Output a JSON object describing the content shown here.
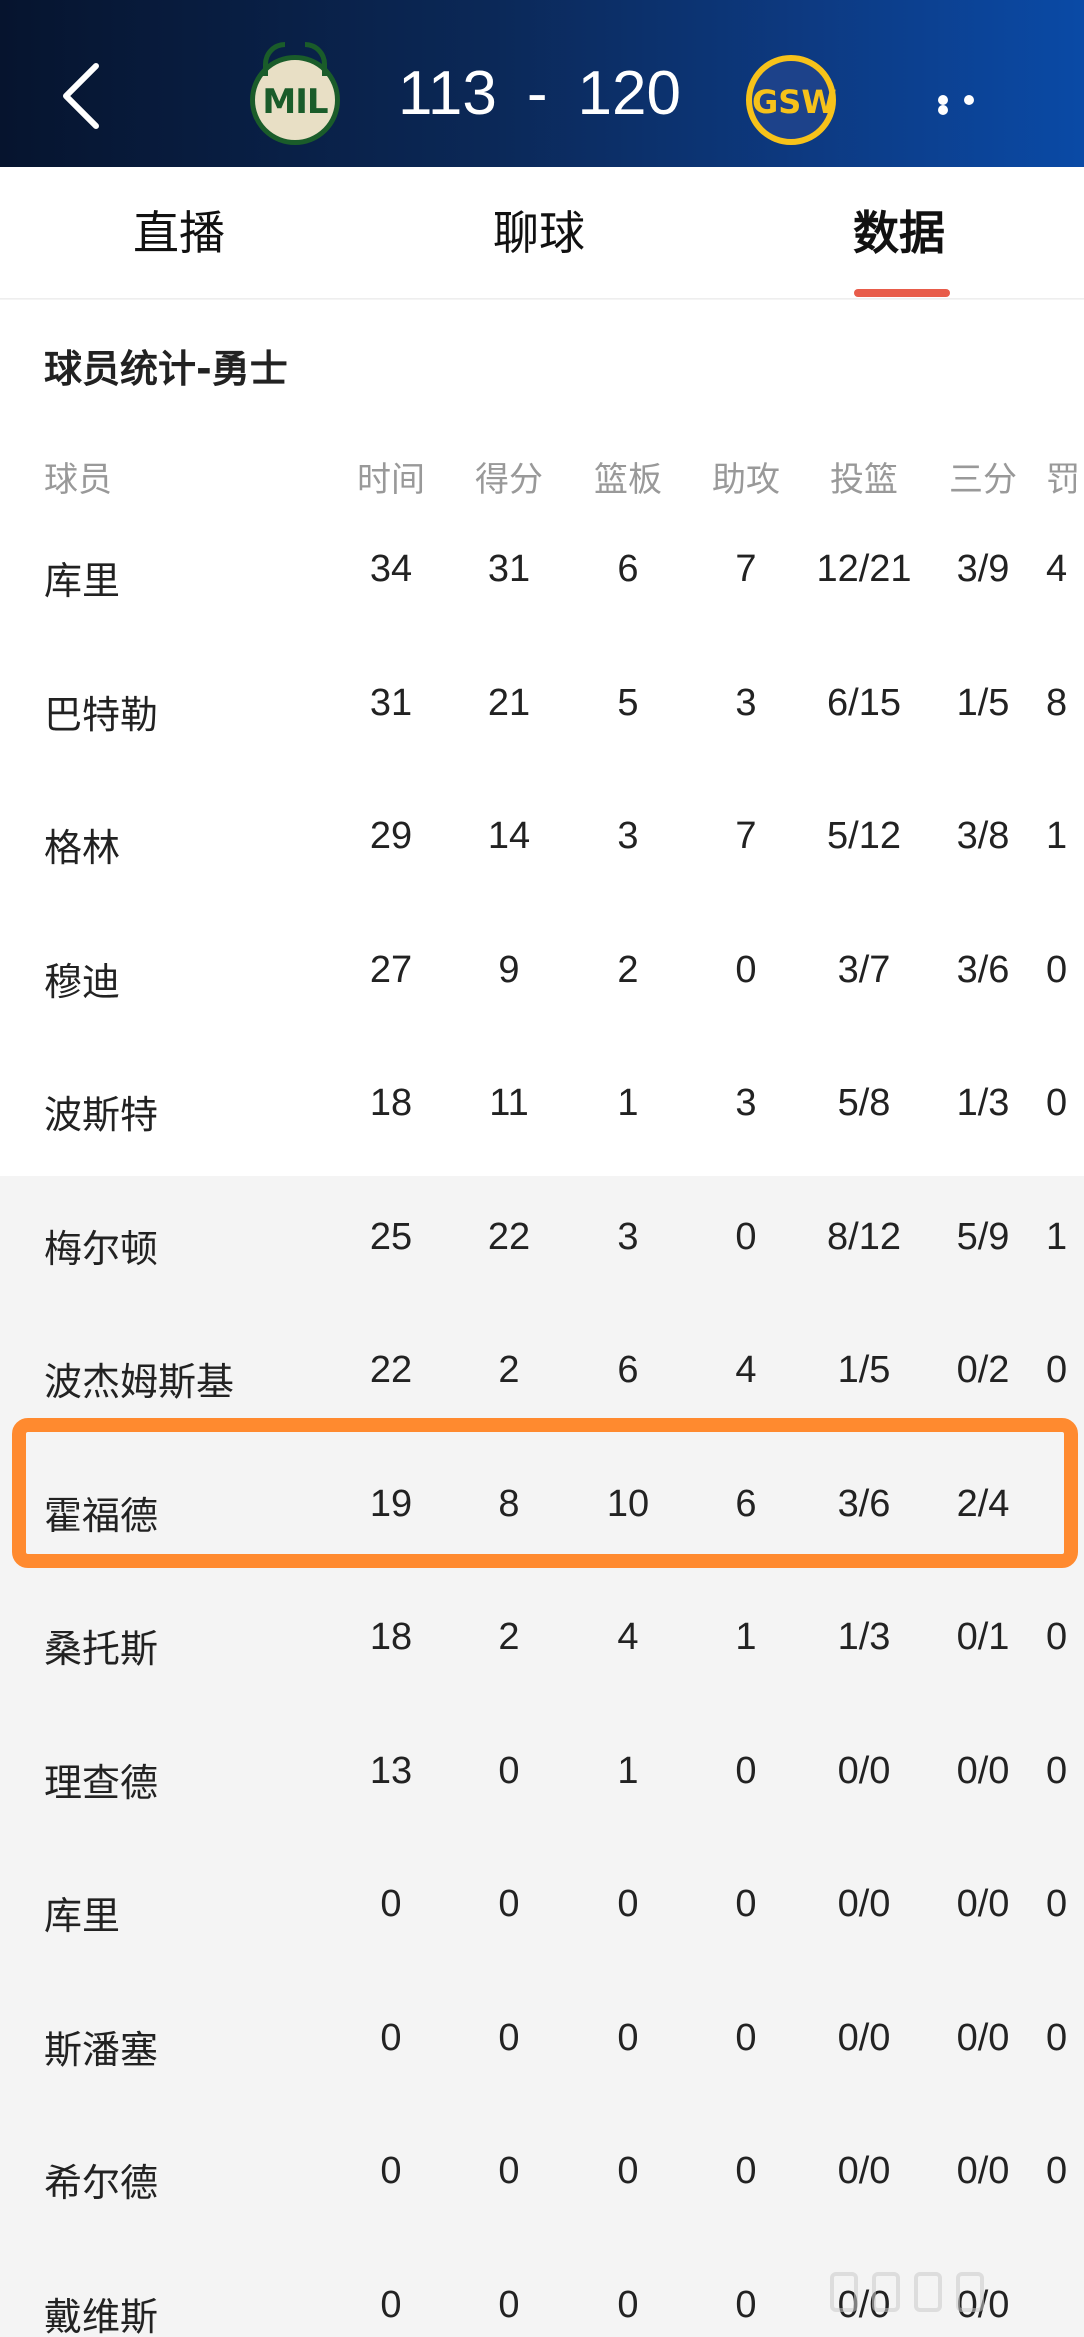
{
  "header": {
    "home_team_abbr": "MIL",
    "away_team_abbr": "GSW",
    "home_score": "113",
    "separator": "-",
    "away_score": "120"
  },
  "tabs": [
    {
      "label": "直播"
    },
    {
      "label": "聊球"
    },
    {
      "label": "数据",
      "active": true
    }
  ],
  "section_title": "球员统计-勇士",
  "table": {
    "columns": [
      "球员",
      "时间",
      "得分",
      "篮板",
      "助攻",
      "投篮",
      "三分",
      "罚"
    ],
    "rows": [
      {
        "name": "库里",
        "stats": [
          "34",
          "31",
          "6",
          "7",
          "12/21",
          "3/9",
          "4"
        ]
      },
      {
        "name": "巴特勒",
        "stats": [
          "31",
          "21",
          "5",
          "3",
          "6/15",
          "1/5",
          "8"
        ]
      },
      {
        "name": "格林",
        "stats": [
          "29",
          "14",
          "3",
          "7",
          "5/12",
          "3/8",
          "1"
        ]
      },
      {
        "name": "穆迪",
        "stats": [
          "27",
          "9",
          "2",
          "0",
          "3/7",
          "3/6",
          "0"
        ]
      },
      {
        "name": "波斯特",
        "stats": [
          "18",
          "11",
          "1",
          "3",
          "5/8",
          "1/3",
          "0"
        ]
      },
      {
        "name": "梅尔顿",
        "stats": [
          "25",
          "22",
          "3",
          "0",
          "8/12",
          "5/9",
          "1"
        ]
      },
      {
        "name": "波杰姆斯基",
        "stats": [
          "22",
          "2",
          "6",
          "4",
          "1/5",
          "0/2",
          "0"
        ]
      },
      {
        "name": "霍福德",
        "stats": [
          "19",
          "8",
          "10",
          "6",
          "3/6",
          "2/4",
          ""
        ]
      },
      {
        "name": "桑托斯",
        "stats": [
          "18",
          "2",
          "4",
          "1",
          "1/3",
          "0/1",
          "0"
        ]
      },
      {
        "name": "理查德",
        "stats": [
          "13",
          "0",
          "1",
          "0",
          "0/0",
          "0/0",
          "0"
        ]
      },
      {
        "name": "库里",
        "stats": [
          "0",
          "0",
          "0",
          "0",
          "0/0",
          "0/0",
          "0"
        ]
      },
      {
        "name": "斯潘塞",
        "stats": [
          "0",
          "0",
          "0",
          "0",
          "0/0",
          "0/0",
          "0"
        ]
      },
      {
        "name": "希尔德",
        "stats": [
          "0",
          "0",
          "0",
          "0",
          "0/0",
          "0/0",
          "0"
        ]
      },
      {
        "name": "戴维斯",
        "stats": [
          "0",
          "0",
          "0",
          "0",
          "0/0",
          "0/0",
          ""
        ]
      }
    ]
  },
  "colors": {
    "accent": "#e85c4a",
    "highlight": "#ff8a2f"
  },
  "icons": {
    "back": "chevron-left-icon",
    "more": "more-dots-icon"
  }
}
